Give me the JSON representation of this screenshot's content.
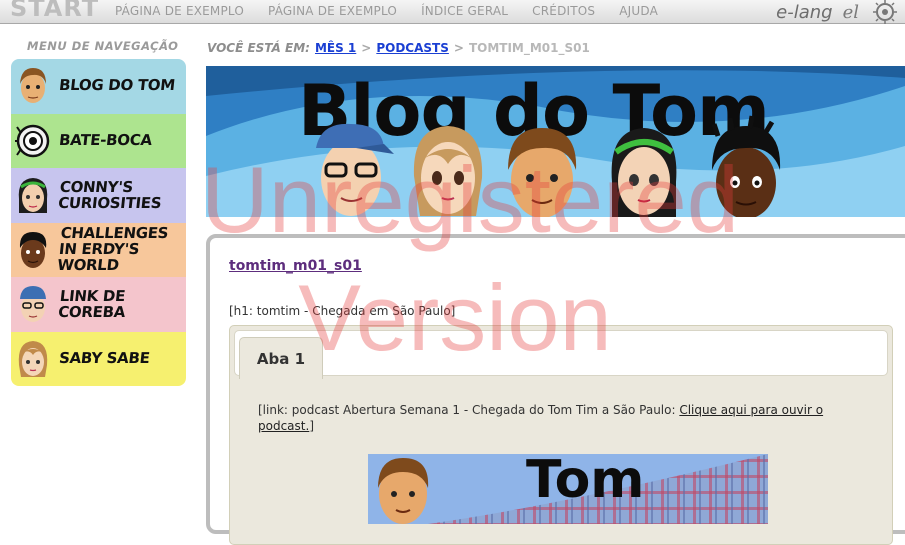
{
  "brand": "START",
  "topnav": [
    {
      "label": "PÁGINA DE EXEMPLO"
    },
    {
      "label": "PÁGINA DE EXEMPLO"
    },
    {
      "label": "ÍNDICE GERAL"
    },
    {
      "label": "CRÉDITOS"
    },
    {
      "label": "AJUDA"
    }
  ],
  "logos": {
    "elang": "e-lang",
    "el": "el"
  },
  "menu": {
    "title": "MENU DE NAVEGAÇÃO",
    "items": [
      {
        "label": "BLOG DO TOM",
        "color": "#a4d8e5",
        "icon": "tom-face-icon"
      },
      {
        "label": "BATE-BOCA",
        "color": "#ade48f",
        "icon": "speaker-icon"
      },
      {
        "label": "CONNY'S CURIOSITIES",
        "color": "#c7c5ee",
        "icon": "conny-face-icon"
      },
      {
        "label": "CHALLENGES IN ERDY'S WORLD",
        "color": "#f7c79b",
        "icon": "erdy-face-icon"
      },
      {
        "label": "LINK DE COREBA",
        "color": "#f4c5cc",
        "icon": "coreba-face-icon"
      },
      {
        "label": "SABY SABE",
        "color": "#f6f06f",
        "icon": "saby-face-icon"
      }
    ]
  },
  "breadcrumb": {
    "label": "VOCÊ ESTÁ EM:",
    "links": [
      "MÊS 1",
      "PODCASTS"
    ],
    "separator": ">",
    "current": "TOMTIM_M01_S01"
  },
  "banner": {
    "title": "Blog do Tom"
  },
  "post": {
    "title": "tomtim_m01_s01",
    "h1": "[h1: tomtim - Chegada em São Paulo]",
    "tab": "Aba 1",
    "podcast_prefix": "[link: podcast Abertura Semana 1 - Chegada do Tom Tim a São Paulo: ",
    "podcast_link": "Clique aqui para ouvir o podcast.",
    "podcast_suffix": "]",
    "image_title": "Tom"
  },
  "watermark": {
    "line1": "Unregistered",
    "line2": "Version"
  }
}
